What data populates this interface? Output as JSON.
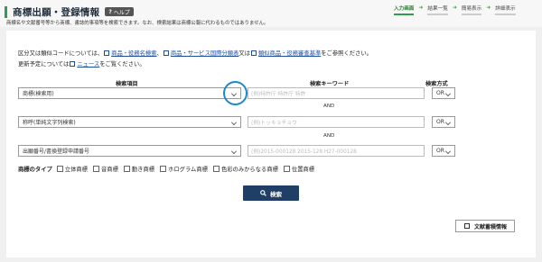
{
  "header": {
    "title": "商標出願・登録情報",
    "help_label": "ヘルプ",
    "description": "商標名や文献番号等から商標、書誌的事項等を検索できます。なお、検索結果は商標公報に代わるものではありません。"
  },
  "steps": [
    {
      "label": "入力画面",
      "active": true
    },
    {
      "label": "結果一覧",
      "active": false
    },
    {
      "label": "簡易表示",
      "active": false
    },
    {
      "label": "詳細表示",
      "active": false
    }
  ],
  "note": {
    "line1_prefix": "区分又は類似コードについては、",
    "link1": "商品・役務名検索",
    "sep1": "、",
    "link2": "商品・サービス国際分類表",
    "mid": "又は",
    "link3": "類似商品・役務審査基準",
    "line1_suffix": "をご参照ください。",
    "line2_prefix": "更新予定については",
    "link4": "ニュース",
    "line2_suffix": "をご覧ください。"
  },
  "columns": {
    "item": "検索項目",
    "keyword": "検索キーワード",
    "method": "検索方式"
  },
  "rows": [
    {
      "item": "商標(検索用)",
      "placeholder": "(例)特許庁 特許庁 特許",
      "method": "OR"
    },
    {
      "item": "称呼(単純文字列検索)",
      "placeholder": "(例)トッキョチョウ",
      "method": "OR"
    },
    {
      "item": "出願番号/書換登録申請番号",
      "placeholder": "(例)2015-000128 2015-128 H27-000128",
      "method": "OR"
    }
  ],
  "and_label": "AND",
  "types": {
    "label": "商標のタイプ",
    "options": [
      "立体商標",
      "音商標",
      "動き商標",
      "ホログラム商標",
      "色彩のみからなる商標",
      "位置商標"
    ]
  },
  "search_button": "検索",
  "doc_button": "文献蓄積情報"
}
